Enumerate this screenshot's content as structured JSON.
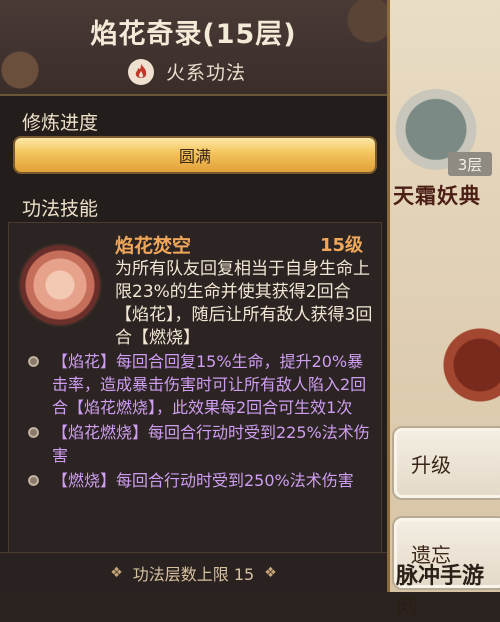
{
  "header": {
    "title": "焰花奇录(15层)",
    "element_label": "火系功法"
  },
  "progress": {
    "section_label": "修炼进度",
    "bar_label": "圆满",
    "fill_fraction": 1.0
  },
  "skill": {
    "section_label": "功法技能",
    "name": "焰花焚空",
    "level": "15级",
    "description": "为所有队友回复相当于自身生命上限23%的生命并使其获得2回合【焰花】，随后让所有敌人获得3回合【燃烧】",
    "effects": [
      "【焰花】每回合回复15%生命，提升20%暴击率，造成暴击伤害时可让所有敌人陷入2回合【焰花燃烧】，此效果每2回合可生效1次",
      "【焰花燃烧】每回合行动时受到225%法术伤害",
      "【燃烧】每回合行动时受到250%法术伤害"
    ]
  },
  "footer": {
    "label": "功法层数上限 15"
  },
  "side": {
    "layer_badge": "3层",
    "book_title": "天霜妖典",
    "upgrade_button": "升级",
    "forget_button": "遗忘"
  },
  "watermark": "脉冲手游网",
  "colors": {
    "panel_bg": "#231d1b",
    "skill_name": "#f0a75a",
    "effect_text": "#cf9ef2",
    "progress_gold": "#f3c35a"
  },
  "icons": [
    "fire-icon",
    "skill-emblem-icon",
    "bullet-icon",
    "footer-ornament-icon"
  ]
}
